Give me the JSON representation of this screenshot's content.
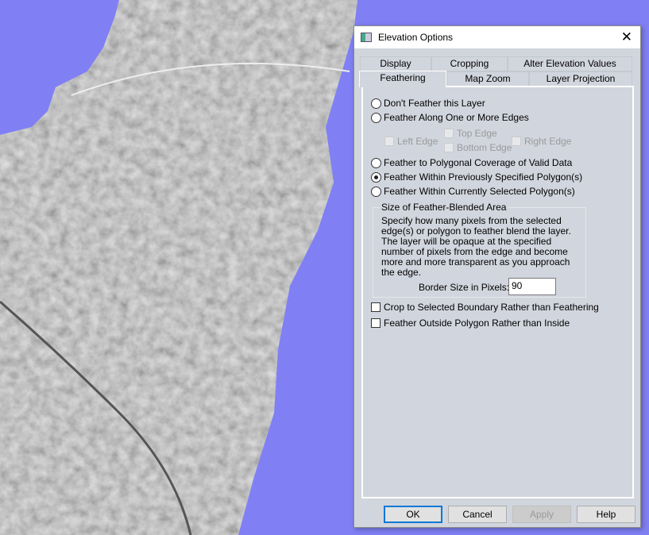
{
  "dialog": {
    "title": "Elevation Options",
    "tabs_row1": [
      "Display",
      "Cropping",
      "Alter Elevation Values"
    ],
    "tabs_row2": [
      "Feathering",
      "Map Zoom",
      "Layer Projection"
    ],
    "active_tab": "Feathering",
    "options": {
      "dont_feather": {
        "label": "Don't Feather this Layer",
        "selected": false
      },
      "along_edges": {
        "label": "Feather Along One or More Edges",
        "selected": false
      },
      "edges": {
        "left": "Left Edge",
        "top": "Top Edge",
        "bottom": "Bottom Edge",
        "right": "Right Edge"
      },
      "polygonal_coverage": {
        "label": "Feather to Polygonal Coverage of Valid Data",
        "selected": false
      },
      "previously_specified": {
        "label": "Feather Within Previously Specified Polygon(s)",
        "selected": true
      },
      "currently_selected": {
        "label": "Feather Within Currently Selected Polygon(s)",
        "selected": false
      }
    },
    "group": {
      "title": "Size of Feather-Blended Area",
      "description": "Specify how many pixels from the selected edge(s) or polygon to feather blend the layer. The layer will be opaque at the specified number of pixels from the edge and become more and more transparent as you approach the edge.",
      "border_label": "Border Size in Pixels:",
      "border_value": "90"
    },
    "checkboxes": {
      "crop": {
        "label": "Crop to Selected Boundary Rather than Feathering",
        "checked": false
      },
      "outside": {
        "label": "Feather Outside Polygon Rather than Inside",
        "checked": false
      }
    },
    "buttons": {
      "ok": "OK",
      "cancel": "Cancel",
      "apply": "Apply",
      "help": "Help"
    }
  },
  "colors": {
    "background": "#8080f4",
    "accent": "#0078d7"
  }
}
